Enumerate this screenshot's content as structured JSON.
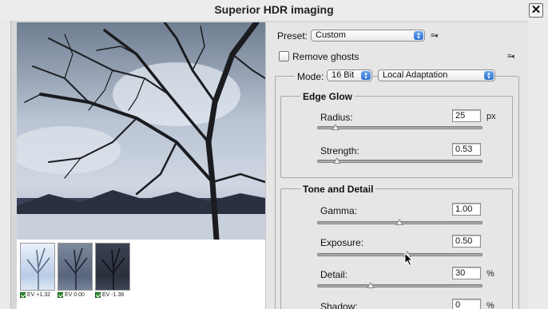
{
  "window": {
    "title": "Superior HDR imaging"
  },
  "preset": {
    "label": "Preset:",
    "value": "Custom"
  },
  "remove_ghosts": {
    "label": "Remove ghosts",
    "checked": false
  },
  "mode": {
    "label": "Mode:",
    "bit_depth": "16 Bit",
    "method": "Local Adaptation"
  },
  "edge_glow": {
    "title": "Edge Glow",
    "radius": {
      "label": "Radius:",
      "value": "25",
      "unit": "px",
      "level": 0.1
    },
    "strength": {
      "label": "Strength:",
      "value": "0.53",
      "level": 0.12
    }
  },
  "tone_detail": {
    "title": "Tone and Detail",
    "gamma": {
      "label": "Gamma:",
      "value": "1.00",
      "level": 0.5
    },
    "exposure": {
      "label": "Exposure:",
      "value": "0.50",
      "level": 0.55
    },
    "detail": {
      "label": "Detail:",
      "value": "30",
      "unit": "%",
      "level": 0.33
    },
    "shadow": {
      "label": "Shadow:",
      "value": "0",
      "unit": "%"
    }
  },
  "thumbnails": [
    {
      "label": "EV +1.32",
      "checked": true
    },
    {
      "label": "EV 0.00",
      "checked": true
    },
    {
      "label": "EV -1.36",
      "checked": true
    }
  ],
  "icons": {
    "close": "close-icon",
    "menu": "panel-menu-icon",
    "select_arrow": "stepper-arrows-icon"
  },
  "colors": {
    "accent": "#3a7fdc",
    "check": "#2f8f2f"
  }
}
